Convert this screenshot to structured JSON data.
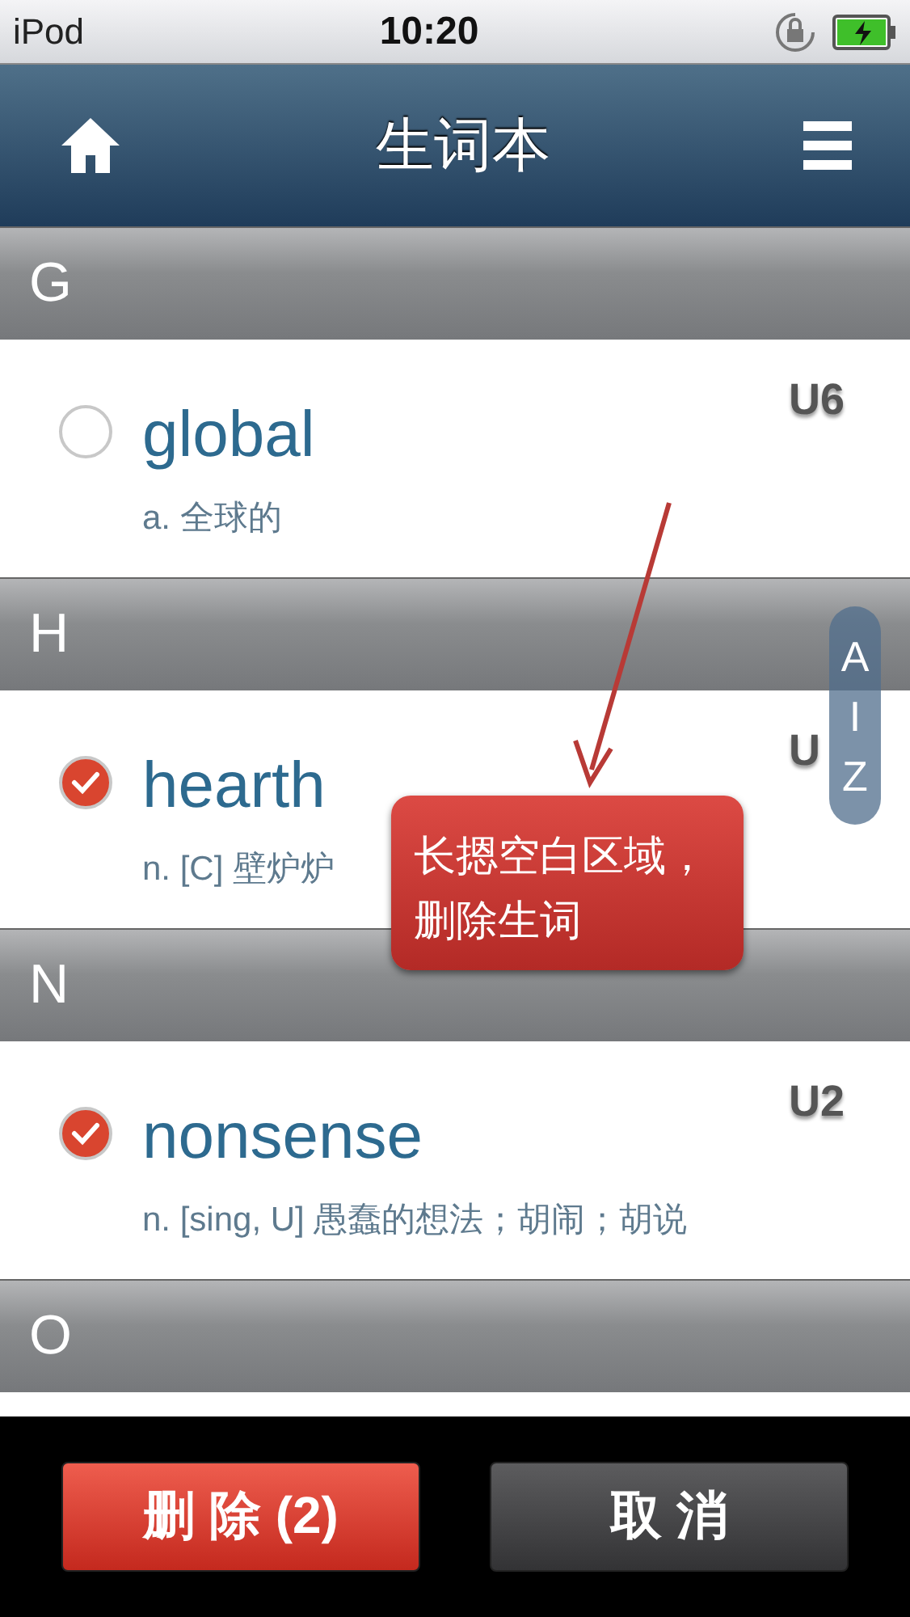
{
  "status_bar": {
    "carrier": "iPod",
    "time": "10:20"
  },
  "nav_bar": {
    "title": "生词本"
  },
  "sections": [
    {
      "letter": "G",
      "words": [
        {
          "word": "global",
          "definition": "a. 全球的",
          "unit": "U6",
          "selected": false
        }
      ]
    },
    {
      "letter": "H",
      "words": [
        {
          "word": "hearth",
          "definition": "n. [C] 壁炉炉",
          "unit": "U",
          "selected": true
        }
      ]
    },
    {
      "letter": "N",
      "words": [
        {
          "word": "nonsense",
          "definition": "n. [sing, U] 愚蠢的想法；胡闹；胡说",
          "unit": "U2",
          "selected": true
        }
      ]
    },
    {
      "letter": "O"
    }
  ],
  "index_bar": {
    "letters": [
      "A",
      "I",
      "Z"
    ]
  },
  "callout": {
    "lines": [
      "长摁空白区域，",
      "删除生词"
    ]
  },
  "toolbar": {
    "buttons": [
      {
        "label": "删 除 (2)",
        "kind": "destructive"
      },
      {
        "label": "取 消",
        "kind": "cancel"
      }
    ]
  }
}
